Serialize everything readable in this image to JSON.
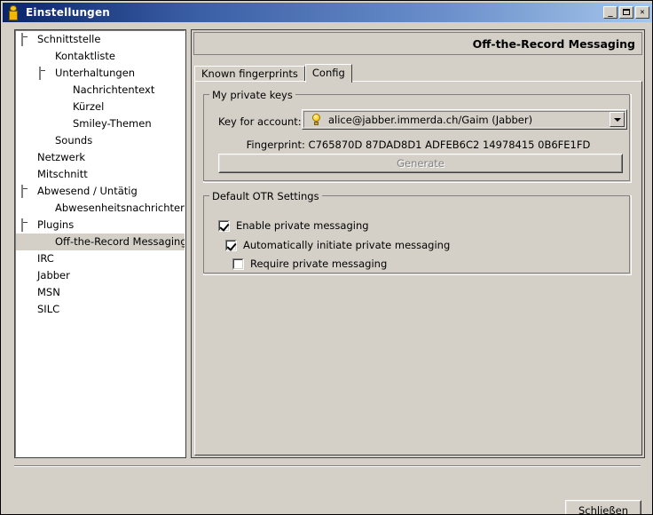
{
  "window": {
    "title": "Einstellungen",
    "icon": "person-icon",
    "buttons": {
      "minimize": "_",
      "maximize": "□",
      "close": "✕"
    }
  },
  "sidebar": {
    "items": [
      {
        "label": "Schnittstelle",
        "indent": 0,
        "expander": true,
        "selected": false
      },
      {
        "label": "Kontaktliste",
        "indent": 1,
        "expander": false,
        "selected": false
      },
      {
        "label": "Unterhaltungen",
        "indent": 1,
        "expander": true,
        "selected": false
      },
      {
        "label": "Nachrichtentext",
        "indent": 2,
        "expander": false,
        "selected": false
      },
      {
        "label": "Kürzel",
        "indent": 2,
        "expander": false,
        "selected": false
      },
      {
        "label": "Smiley-Themen",
        "indent": 2,
        "expander": false,
        "selected": false
      },
      {
        "label": "Sounds",
        "indent": 1,
        "expander": false,
        "selected": false
      },
      {
        "label": "Netzwerk",
        "indent": 0,
        "expander": false,
        "selected": false
      },
      {
        "label": "Mitschnitt",
        "indent": 0,
        "expander": false,
        "selected": false
      },
      {
        "label": "Abwesend / Untätig",
        "indent": 0,
        "expander": true,
        "selected": false
      },
      {
        "label": "Abwesenheitsnachrichten",
        "indent": 1,
        "expander": false,
        "selected": false
      },
      {
        "label": "Plugins",
        "indent": 0,
        "expander": true,
        "selected": false
      },
      {
        "label": "Off-the-Record Messaging",
        "indent": 1,
        "expander": false,
        "selected": true
      },
      {
        "label": "IRC",
        "indent": 0,
        "expander": false,
        "selected": false
      },
      {
        "label": "Jabber",
        "indent": 0,
        "expander": false,
        "selected": false
      },
      {
        "label": "MSN",
        "indent": 0,
        "expander": false,
        "selected": false
      },
      {
        "label": "SILC",
        "indent": 0,
        "expander": false,
        "selected": false
      }
    ]
  },
  "panel": {
    "header_title": "Off-the-Record Messaging",
    "tabs": [
      {
        "label": "Known fingerprints",
        "active": false
      },
      {
        "label": "Config",
        "active": true
      }
    ],
    "private_keys": {
      "group_title": "My private keys",
      "account_label": "Key for account:",
      "account_icon": "lightbulb-icon",
      "account_value": "alice@jabber.immerda.ch/Gaim (Jabber)",
      "fingerprint": "Fingerprint: C765870D 87DAD8D1 ADFEB6C2 14978415 0B6FE1FD",
      "generate_label": "Generate",
      "generate_disabled": true
    },
    "otr_settings": {
      "group_title": "Default OTR Settings",
      "options": [
        {
          "label": "Enable private messaging",
          "checked": true,
          "indent": 0
        },
        {
          "label": "Automatically initiate private messaging",
          "checked": true,
          "indent": 1
        },
        {
          "label": "Require private messaging",
          "checked": false,
          "indent": 2
        }
      ]
    }
  },
  "footer": {
    "close_button_prefix": "S",
    "close_button_mnemonic": "c",
    "close_button_suffix": "hließen",
    "close_button_label": "Schließen"
  },
  "colors": {
    "face": "#d4d0c8",
    "title_gradient_start": "#0a246a",
    "title_gradient_end": "#a6c6ea",
    "white": "#ffffff",
    "shadow": "#404040",
    "disabled_text": "#808080"
  }
}
